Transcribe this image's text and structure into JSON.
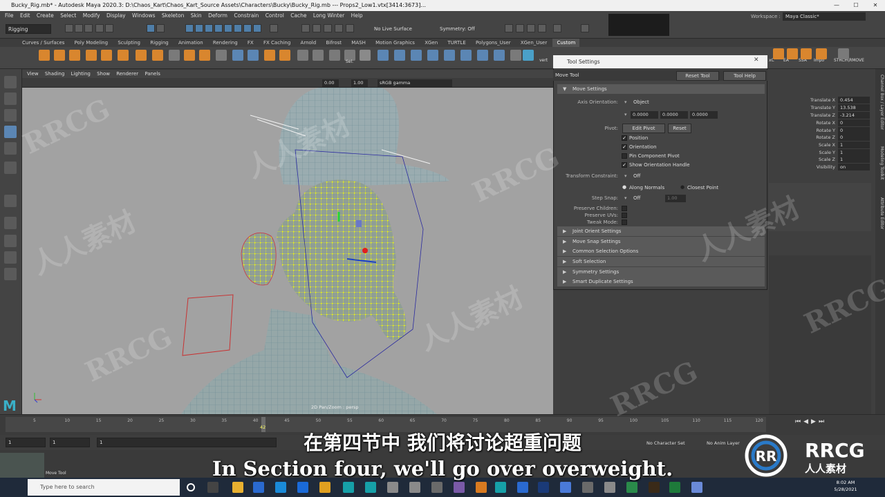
{
  "window": {
    "title": "Bucky_Rig.mb* - Autodesk Maya 2020.3: D:\\Chaos_Kart\\Chaos_Kart_Source Assets\\Characters\\Bucky\\Bucky_Rig.mb  ---  Props2_Low1.vtx[3414:3673]...",
    "min": "—",
    "max": "☐",
    "close": "✕"
  },
  "menu": [
    "File",
    "Edit",
    "Create",
    "Select",
    "Modify",
    "Display",
    "Windows",
    "Skeleton",
    "Skin",
    "Deform",
    "Constrain",
    "Control",
    "Cache",
    "Long Winter",
    "Help"
  ],
  "status": {
    "mode": "Rigging",
    "live_surface": "No Live Surface",
    "symmetry": "Symmetry: Off",
    "workspace_label": "Workspace :",
    "workspace": "Maya Classic*"
  },
  "shelf_tabs": [
    "Curves / Surfaces",
    "Poly Modeling",
    "Sculpting",
    "Rigging",
    "Animation",
    "Rendering",
    "FX",
    "FX Caching",
    "Arnold",
    "Bifrost",
    "MASH",
    "Motion Graphics",
    "XGen",
    "TURTLE",
    "Polygons_User",
    "XGen_User",
    "Custom"
  ],
  "shelf_active": "Custom",
  "shelf_labels": [
    "Sel.",
    "vert",
    "xC",
    "EA",
    "SSA",
    "Impo",
    "STRCH\\RMOVE"
  ],
  "panel_menu": [
    "View",
    "Shading",
    "Lighting",
    "Show",
    "Renderer",
    "Panels"
  ],
  "panel_fields": {
    "exposure": "0.00",
    "gamma": "1.00",
    "colorspace": "sRGB gamma"
  },
  "camera_label": "2D Pan/Zoom : persp",
  "tool_settings": {
    "title": "Tool Settings",
    "tool_name": "Move Tool",
    "reset_button": "Reset Tool",
    "help_button": "Tool Help",
    "section": "Move Settings",
    "axis_orientation_label": "Axis Orientation:",
    "axis_orientation": "Object",
    "axis_values": [
      "0.0000",
      "0.0000",
      "0.0000"
    ],
    "pivot_label": "Pivot:",
    "edit_pivot": "Edit Pivot",
    "reset": "Reset",
    "checks": [
      {
        "label": "Position",
        "checked": true
      },
      {
        "label": "Orientation",
        "checked": true
      },
      {
        "label": "Pin Component Pivot",
        "checked": false
      },
      {
        "label": "Show Orientation Handle",
        "checked": true
      }
    ],
    "transform_constraint_label": "Transform Constraint:",
    "transform_constraint": "Off",
    "along_normals": "Along Normals",
    "closest_point": "Closest Point",
    "step_snap_label": "Step Snap:",
    "step_snap": "Off",
    "step_value": "1.00",
    "preserve_children": "Preserve Children:",
    "preserve_uvs": "Preserve UVs:",
    "tweak_mode": "Tweak Mode:",
    "collapsed_sections": [
      "Joint Orient Settings",
      "Move Snap Settings",
      "Common Selection Options",
      "Soft Selection",
      "Symmetry Settings",
      "Smart Duplicate Settings"
    ]
  },
  "channel_box": {
    "rows": [
      {
        "label": "Translate X",
        "value": "0.454"
      },
      {
        "label": "Translate Y",
        "value": "13.538"
      },
      {
        "label": "Translate Z",
        "value": "-3.214"
      },
      {
        "label": "Rotate X",
        "value": "0"
      },
      {
        "label": "Rotate Y",
        "value": "0"
      },
      {
        "label": "Rotate Z",
        "value": "0"
      },
      {
        "label": "Scale X",
        "value": "1"
      },
      {
        "label": "Scale Y",
        "value": "1"
      },
      {
        "label": "Scale Z",
        "value": "1"
      },
      {
        "label": "Visibility",
        "value": "on"
      }
    ],
    "side_tabs": [
      "Channel Box / Layer Editor",
      "Modeling Toolkit",
      "Attribute Editor"
    ]
  },
  "timeline": {
    "ticks": [
      "5",
      "10",
      "15",
      "20",
      "25",
      "30",
      "35",
      "40",
      "45",
      "50",
      "55",
      "60",
      "65",
      "70",
      "75",
      "80",
      "85",
      "90",
      "95",
      "100",
      "105",
      "110",
      "115",
      "120"
    ],
    "current_frame": "42"
  },
  "range": {
    "start": "1",
    "start2": "1",
    "end_field": "1",
    "no_character": "No Character Set",
    "no_anim_layer": "No Anim Layer"
  },
  "help_line": "Move Tool",
  "taskbar": {
    "search": "Type here to search",
    "time": "8:02 AM",
    "date": "5/28/2021"
  },
  "subtitles": {
    "cn": "在第四节中 我们将讨论超重问题",
    "en": "In Section four, we'll go over overweight."
  },
  "watermark": {
    "latin": "RRCG",
    "cn": "人人素材"
  }
}
